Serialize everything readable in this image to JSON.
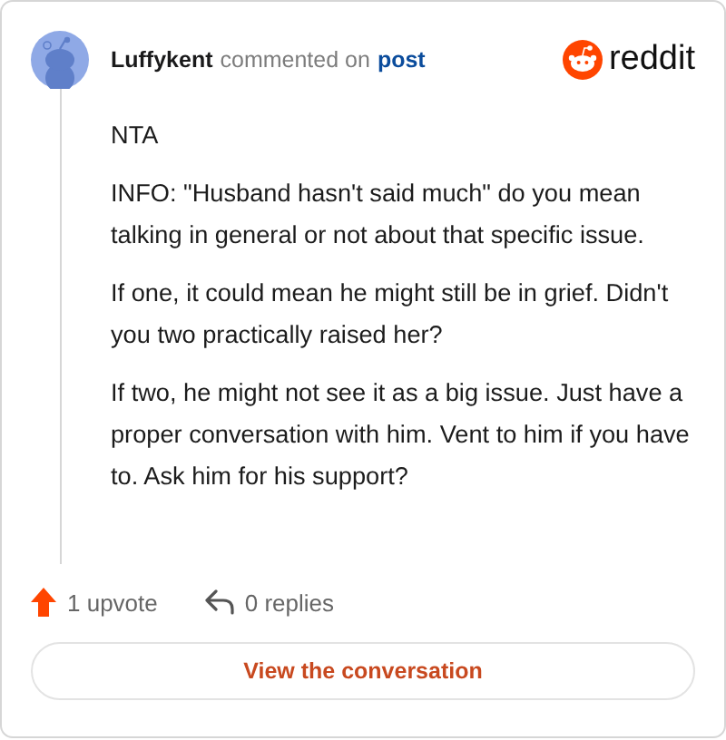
{
  "comment": {
    "author": "Luffykent",
    "action": "commented on",
    "target": "post",
    "brand": "reddit",
    "paragraphs": [
      "NTA",
      "INFO: \"Husband hasn't said much\" do you mean talking in general or not about that specific issue.",
      "If one, it could mean he might still be in grief. Didn't you two practically raised her?",
      "If two, he might not see it as a big issue. Just have a proper conversation with him. Vent to him if you have to. Ask him for his support?"
    ]
  },
  "upvotes": "1 upvote",
  "replies": "0 replies",
  "button": "View the conversation"
}
